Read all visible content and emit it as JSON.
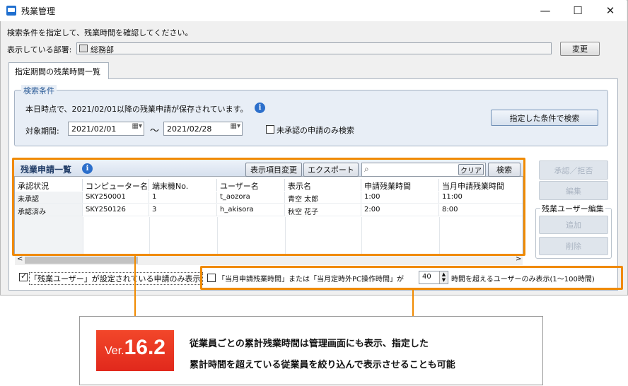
{
  "window": {
    "title": "残業管理",
    "controls": {
      "minimize": "—",
      "maximize": "☐",
      "close": "✕"
    },
    "icon": "app-window-icon"
  },
  "header": {
    "instruction": "検索条件を指定して、残業時間を確認してください。",
    "department_label": "表示している部署:",
    "department_value": "総務部",
    "change_button": "変更"
  },
  "tabs": [
    {
      "label": "指定期間の残業時間一覧",
      "active": true
    }
  ],
  "search": {
    "group_title": "検索条件",
    "notice": "本日時点で、2021/02/01以降の残業申請が保存されています。",
    "period_label": "対象期間:",
    "date_from": "2021/02/01",
    "date_to": "2021/02/28",
    "separator": "～",
    "unapproved_only_label": "未承認の申請のみ検索",
    "unapproved_only_checked": false,
    "search_button": "指定した条件で検索"
  },
  "list": {
    "title": "残業申請一覧",
    "toolbar": {
      "columns_button": "表示項目変更",
      "export_button": "エクスポート",
      "search_placeholder": "",
      "clear_button": "クリア",
      "search_button": "検索"
    },
    "columns": [
      "承認状況",
      "コンピューター名",
      "端末機No.",
      "ユーザー名",
      "表示名",
      "申請残業時間",
      "当月申請残業時間"
    ],
    "rows": [
      [
        "未承認",
        "SKY250001",
        "1",
        "t_aozora",
        "青空 太郎",
        "1:00",
        "11:00"
      ],
      [
        "承認済み",
        "SKY250126",
        "3",
        "h_akisora",
        "秋空 花子",
        "2:00",
        "8:00"
      ]
    ],
    "scroll_left": "<",
    "scroll_right": ">"
  },
  "side_actions": {
    "approve_reject": "承認／拒否",
    "edit": "編集",
    "group_title": "残業ユーザー編集",
    "add": "追加",
    "delete": "削除"
  },
  "filters": {
    "overtime_user_only_label": "「残業ユーザー」が設定されている申請のみ表示",
    "overtime_user_only_checked": true,
    "threshold_prefix": "「当月申請残業時間」または「当月定時外PC操作時間」が",
    "threshold_value": "40",
    "threshold_suffix": "時間を超えるユーザーのみ表示(1〜100時間)",
    "threshold_checked": false
  },
  "annotation": {
    "version_prefix": "Ver.",
    "version_number": "16.2",
    "line1": "従業員ごとの累計残業時間は管理画面にも表示、指定した",
    "line2": "累計時間を超えている従業員を絞り込んで表示させることも可能"
  },
  "colors": {
    "callout": "#f08a00",
    "badge": "#e1281c",
    "accent": "#2c6fcb"
  }
}
